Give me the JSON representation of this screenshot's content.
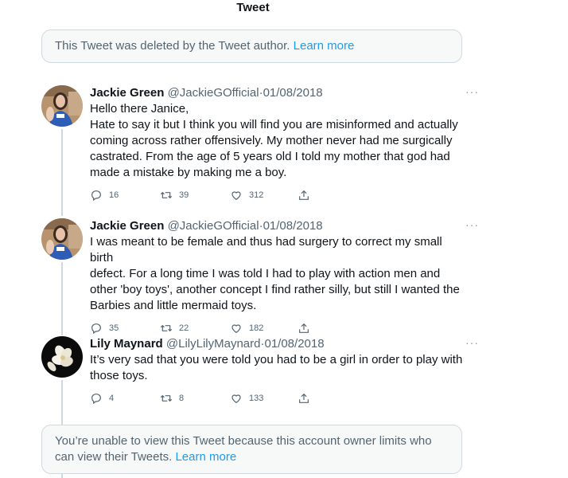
{
  "header": {
    "title": "Tweet"
  },
  "notices": {
    "deleted": {
      "text": "This Tweet was deleted by the Tweet author.",
      "link": "Learn more"
    },
    "limited": {
      "text": "You’re unable to view this Tweet because this account owner limits who can view their Tweets.",
      "link": "Learn more"
    }
  },
  "tweets": [
    {
      "name": "Jackie Green",
      "handle": "@JackieGOfficial",
      "separator": "·",
      "date": "01/08/2018",
      "more": "···",
      "lines": [
        "Hello there Janice,",
        "Hate to say it but I think you will find you are misinformed and actually",
        "coming across rather offensively. My mother never had me surgically",
        "castrated. From the age of 5 years old I told my mother that god had",
        "made a mistake by making me a boy."
      ],
      "replies": "16",
      "retweets": "39",
      "likes": "312"
    },
    {
      "name": "Jackie Green",
      "handle": "@JackieGOfficial",
      "separator": "·",
      "date": "01/08/2018",
      "more": "···",
      "lines": [
        "I was meant to be female and thus had surgery to correct my small birth",
        "defect.  For a long time I was told I had to play with action men and",
        "other 'boy toys', another concept I find rather silly, but still I wanted the",
        "Barbies and little mermaid toys."
      ],
      "replies": "35",
      "retweets": "22",
      "likes": "182"
    },
    {
      "name": "Lily Maynard",
      "handle": "@LilyLilyMaynard",
      "separator": "·",
      "date": "01/08/2018",
      "more": "···",
      "lines": [
        "It’s very sad that you were told you had to be a girl in order to play with",
        "those toys."
      ],
      "replies": "4",
      "retweets": "8",
      "likes": "133"
    }
  ],
  "icons": {
    "reply": "reply-icon",
    "retweet": "retweet-icon",
    "like": "heart-icon",
    "share": "share-icon",
    "more": "more-icon"
  },
  "colors": {
    "link": "#1d9bf0",
    "muted": "#536471",
    "text": "#0f1419",
    "border": "#cfd9de",
    "notice_bg": "#f7f9f9"
  }
}
